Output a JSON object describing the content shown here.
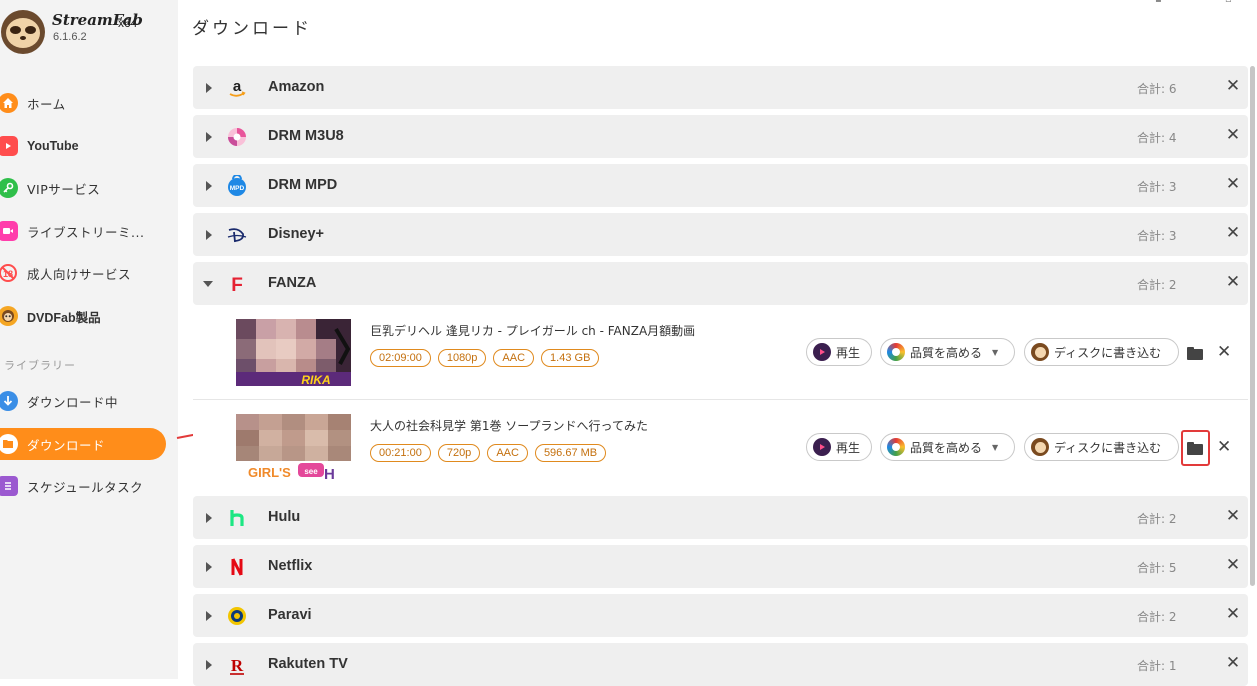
{
  "app": {
    "name": "StreamFab",
    "arch": "x64",
    "version": "6.1.6.2"
  },
  "sidebar": {
    "items": [
      {
        "label": "ホーム",
        "icon": "home-icon",
        "color": "#ff8d1a"
      },
      {
        "label": "YouTube",
        "icon": "youtube-icon",
        "color": "#ff4d4d"
      },
      {
        "label": "VIPサービス",
        "icon": "key-icon",
        "color": "#2fbf4a"
      },
      {
        "label": "ライブストリーミ...",
        "icon": "live-camera-icon",
        "color": "#ff3dab"
      },
      {
        "label": "成人向けサービス",
        "icon": "adult-restricted-icon",
        "color": "#ff4d4d"
      },
      {
        "label": "DVDFab製品",
        "icon": "dvdfab-icon",
        "color": "#f5a623"
      }
    ],
    "library_label": "ライブラリー",
    "library_items": [
      {
        "label": "ダウンロード中",
        "icon": "download-arrow-icon",
        "color": "#3a8ee6"
      },
      {
        "label": "ダウンロード",
        "icon": "folder-icon",
        "color": "#ff8d1a"
      },
      {
        "label": "スケジュールタスク",
        "icon": "schedule-list-icon",
        "color": "#9b59d0"
      }
    ]
  },
  "main": {
    "title": "ダウンロード",
    "groups": [
      {
        "name": "Amazon",
        "count": "合計: 6",
        "icon": "amazon-icon",
        "expanded": false
      },
      {
        "name": "DRM M3U8",
        "count": "合計: 4",
        "icon": "drm-m3u8-icon",
        "expanded": false
      },
      {
        "name": "DRM MPD",
        "count": "合計: 3",
        "icon": "drm-mpd-icon",
        "expanded": false
      },
      {
        "name": "Disney+",
        "count": "合計: 3",
        "icon": "disney-plus-icon",
        "expanded": false
      },
      {
        "name": "FANZA",
        "count": "合計: 2",
        "icon": "fanza-icon",
        "expanded": true
      },
      {
        "name": "Hulu",
        "count": "合計: 2",
        "icon": "hulu-icon",
        "expanded": false
      },
      {
        "name": "Netflix",
        "count": "合計: 5",
        "icon": "netflix-icon",
        "expanded": false
      },
      {
        "name": "Paravi",
        "count": "合計: 2",
        "icon": "paravi-icon",
        "expanded": false
      },
      {
        "name": "Rakuten TV",
        "count": "合計: 1",
        "icon": "rakuten-tv-icon",
        "expanded": false
      }
    ],
    "fanza_items": [
      {
        "title": "巨乳デリヘル 逢見リカ - プレイガール ch - FANZA月額動画",
        "duration": "02:09:00",
        "resolution": "1080p",
        "audio": "AAC",
        "size": "1.43 GB"
      },
      {
        "title": "大人の社会科見学 第1巻 ソープランドへ行ってみた",
        "duration": "00:21:00",
        "resolution": "720p",
        "audio": "AAC",
        "size": "596.67 MB"
      }
    ],
    "buttons": {
      "play": "再生",
      "enhance": "品質を高める",
      "burn": "ディスクに書き込む"
    },
    "thumb_text": {
      "rika": "RIKA",
      "girls": "GIRL'S",
      "see": "see",
      "h": "H"
    }
  },
  "colors": {
    "accent": "#ff8d1a",
    "tag": "#e08a1e",
    "highlight": "#e23a3a"
  }
}
